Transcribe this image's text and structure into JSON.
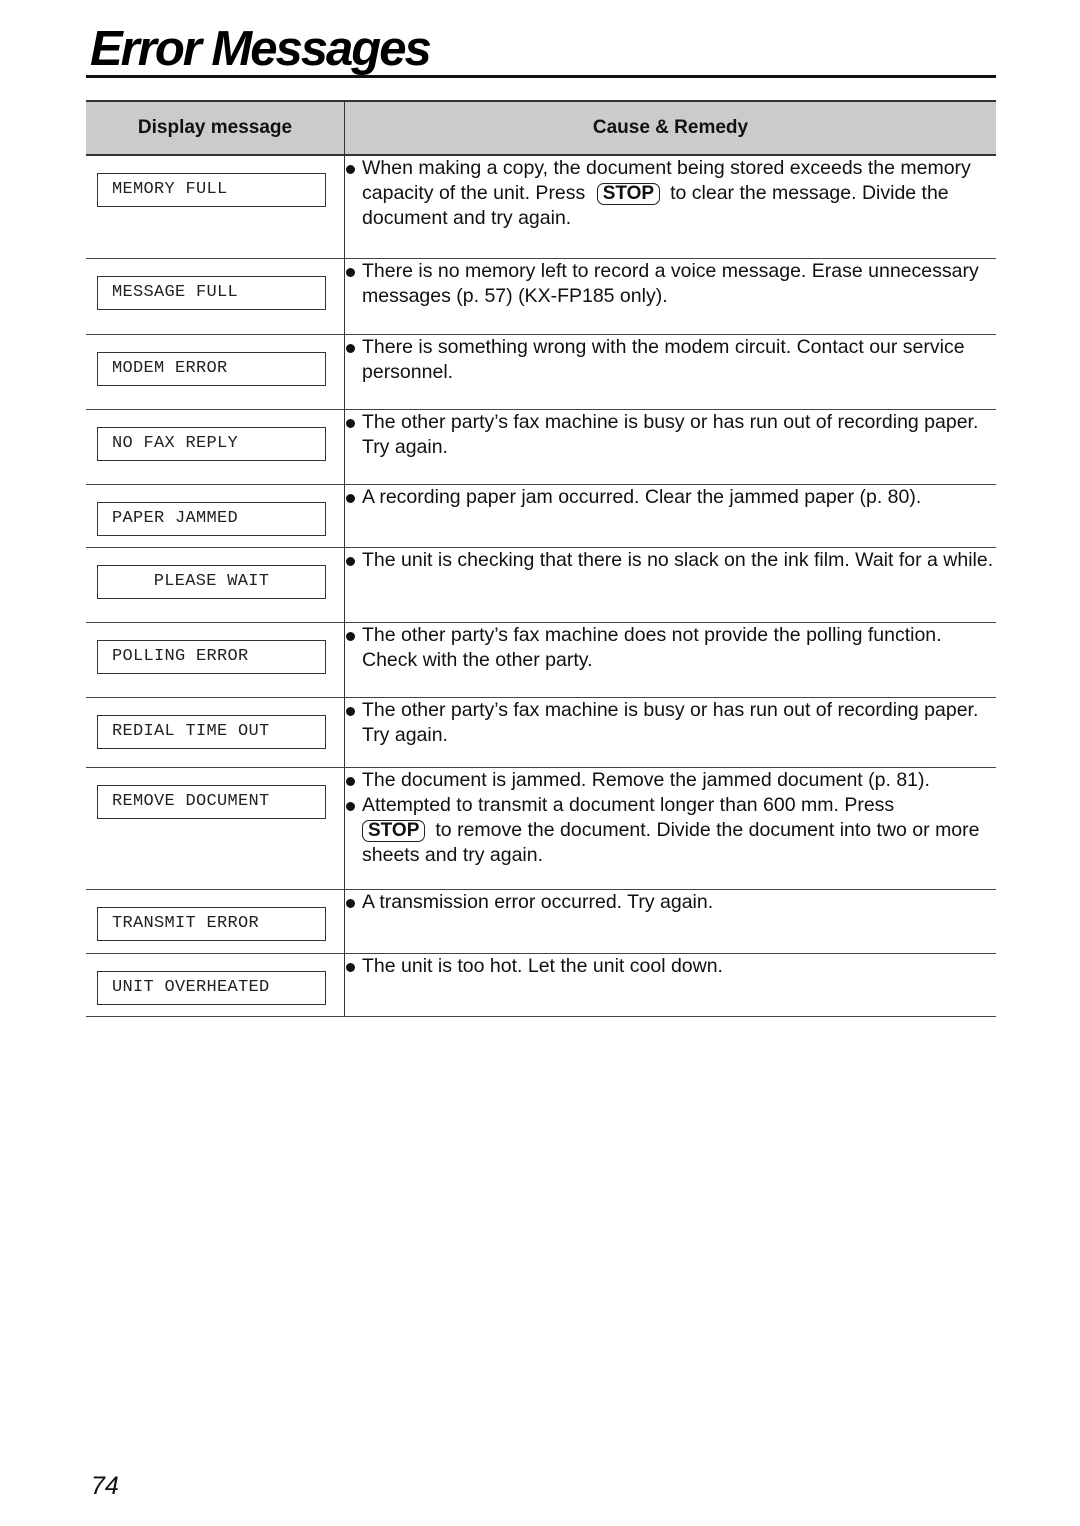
{
  "page": {
    "title": "Error Messages",
    "page_number": "74"
  },
  "table": {
    "headers": {
      "display_message": "Display message",
      "cause_remedy": "Cause & Remedy"
    },
    "stop_key_label": "STOP",
    "rows": [
      {
        "display": "MEMORY FULL",
        "items": [
          {
            "parts": [
              "When making a copy, the document being stored exceeds the memory capacity of the unit. Press",
              "to clear the message. Divide the document and try again."
            ]
          }
        ]
      },
      {
        "display": "MESSAGE FULL",
        "items": [
          {
            "parts": [
              "There is no memory left to record a voice message. Erase unnecessary messages (p. 57) (KX-FP185 only)."
            ]
          }
        ]
      },
      {
        "display": "MODEM ERROR",
        "items": [
          {
            "parts": [
              "There is something wrong with the modem circuit. Contact our service personnel."
            ]
          }
        ]
      },
      {
        "display": "NO FAX REPLY",
        "items": [
          {
            "parts": [
              "The other party’s fax machine is busy or has run out of recording paper. Try again."
            ]
          }
        ]
      },
      {
        "display": "PAPER JAMMED",
        "items": [
          {
            "parts": [
              "A recording paper jam occurred. Clear the jammed paper (p. 80)."
            ]
          }
        ]
      },
      {
        "display": "PLEASE WAIT",
        "items": [
          {
            "parts": [
              "The unit is checking that there is no slack on the ink film. Wait for a while."
            ]
          }
        ]
      },
      {
        "display": "POLLING ERROR",
        "items": [
          {
            "parts": [
              "The other party’s fax machine does not provide the polling function. Check with the other party."
            ]
          }
        ]
      },
      {
        "display": "REDIAL TIME OUT",
        "items": [
          {
            "parts": [
              "The other party’s fax machine is busy or has run out of recording paper. Try again."
            ]
          }
        ]
      },
      {
        "display": "REMOVE DOCUMENT",
        "items": [
          {
            "parts": [
              "The document is jammed. Remove the jammed document (p. 81)."
            ]
          },
          {
            "parts": [
              "Attempted to transmit a document longer than 600 mm. Press",
              "to remove the document. Divide the document into two or more sheets and try again."
            ]
          }
        ]
      },
      {
        "display": "TRANSMIT ERROR",
        "items": [
          {
            "parts": [
              "A transmission error occurred. Try again."
            ]
          }
        ]
      },
      {
        "display": "UNIT OVERHEATED",
        "items": [
          {
            "parts": [
              "The unit is too hot. Let the unit cool down."
            ]
          }
        ]
      }
    ]
  }
}
